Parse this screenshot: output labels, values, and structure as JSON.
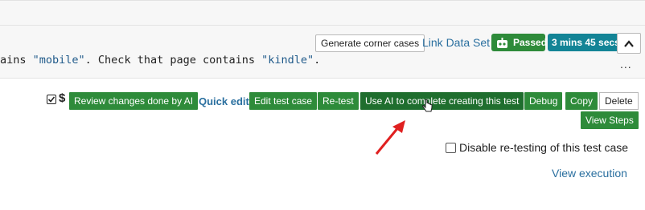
{
  "header": {
    "generate_corner_cases": "Generate corner cases",
    "link_data_set": "Link Data Set",
    "status_badge": "Passed",
    "duration_badge": "3 mins 45 secs"
  },
  "step_text": {
    "part1": "ains ",
    "str1": "\"mobile\"",
    "part2": ". Check that page contains ",
    "str2": "\"kindle\"",
    "part3": ".",
    "more": "..."
  },
  "toolbar": {
    "dollar": "$",
    "review_changes": "Review changes done by AI",
    "quick_edit": "Quick edit",
    "edit_test_case": "Edit test case",
    "retest": "Re-test",
    "use_ai": "Use AI to complete creating this test",
    "debug": "Debug",
    "copy": "Copy",
    "delete": "Delete",
    "view_steps": "View Steps"
  },
  "options": {
    "disable_retesting_label": "Disable re-testing of this test case",
    "view_execution": "View execution"
  },
  "colors": {
    "green": "#2e8b3a",
    "dark_green": "#1f6e2e",
    "teal": "#138496",
    "link": "#2a6f9f",
    "arrow": "#e02020"
  }
}
